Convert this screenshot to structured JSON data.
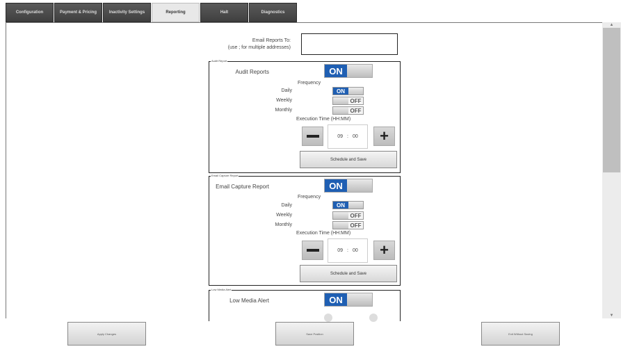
{
  "tabs": [
    {
      "label": "Configuration"
    },
    {
      "label": "Payment & Pricing"
    },
    {
      "label": "Inactivity Settings"
    },
    {
      "label": "Reporting",
      "active": true
    },
    {
      "label": "Halt"
    },
    {
      "label": "Diagnostics"
    }
  ],
  "email": {
    "label_line1": "Email Reports To:",
    "label_line2": "(use ; for multiple addresses)",
    "value": ""
  },
  "sections": [
    {
      "legend": "Audit Report",
      "label": "Audit Reports",
      "toggle": "ON",
      "frequency_label": "Frequency",
      "daily_label": "Daily",
      "daily_state": "ON",
      "weekly_label": "Weekly",
      "weekly_state": "OFF",
      "monthly_label": "Monthly",
      "monthly_state": "OFF",
      "exec_label": "Execution Time (HH:MM)",
      "hour": "09",
      "sep": ":",
      "minute": "00",
      "schedule_label": "Schedule and Save"
    },
    {
      "legend": "Email Capture Report",
      "label": "Email Capture Report",
      "toggle": "ON",
      "frequency_label": "Frequency",
      "daily_label": "Daily",
      "daily_state": "ON",
      "weekly_label": "Weekly",
      "weekly_state": "OFF",
      "monthly_label": "Monthly",
      "monthly_state": "OFF",
      "exec_label": "Execution Time (HH:MM)",
      "hour": "09",
      "sep": ":",
      "minute": "00",
      "schedule_label": "Schedule and Save"
    },
    {
      "legend": "Low Media Alert",
      "label": "Low Media Alert",
      "toggle": "ON"
    }
  ],
  "bottom": {
    "apply": "Apply Changes",
    "save": "Save Position",
    "exit": "Exit Without Saving"
  },
  "colors": {
    "toggle_on": "#1f5fb3",
    "tab_bg": "#4a4a4a"
  },
  "icons": {
    "minus": "minus-icon",
    "plus": "plus-icon"
  }
}
